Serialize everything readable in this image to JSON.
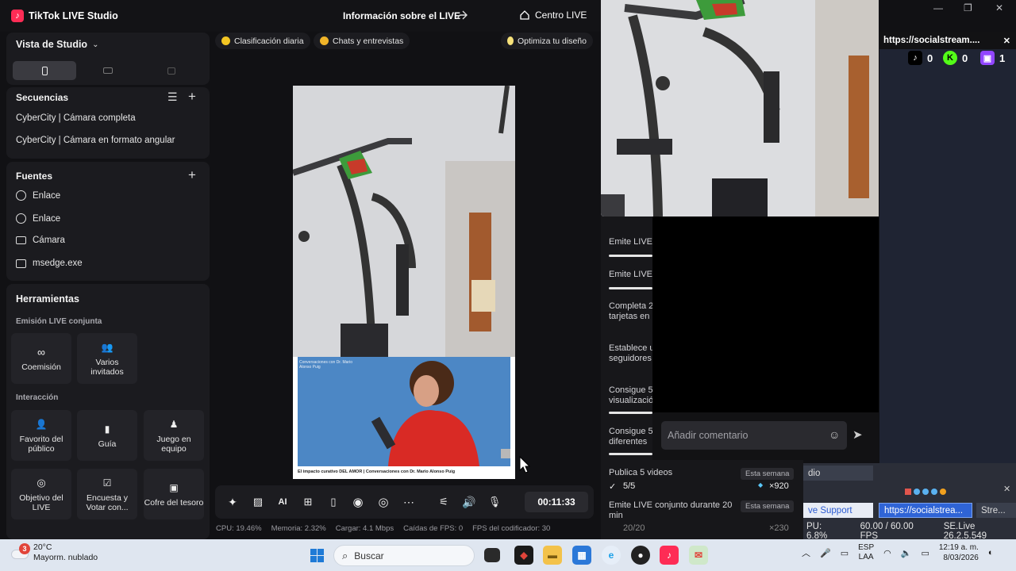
{
  "app": {
    "title": "TikTok LIVE Studio",
    "center_title": "Información sobre el LIVE",
    "live_center": "Centro LIVE"
  },
  "sidebar": {
    "studio_view": "Vista de Studio",
    "sequences_title": "Secuencias",
    "sequences": [
      "CyberCity | Cámara completa",
      "CyberCity | Cámara en formato angular"
    ],
    "sources_title": "Fuentes",
    "sources": [
      {
        "label": "Enlace",
        "icon": "globe-icon"
      },
      {
        "label": "Enlace",
        "icon": "globe-icon"
      },
      {
        "label": "Cámara",
        "icon": "camera-icon"
      },
      {
        "label": "msedge.exe",
        "icon": "window-icon"
      }
    ],
    "tools_title": "Herramientas",
    "co_live_title": "Emisión LIVE conjunta",
    "co_live_tools": [
      "Coemisión",
      "Varios invitados"
    ],
    "interaction_title": "Interacción",
    "interaction_tools": [
      "Favorito del público",
      "Guía",
      "Juego en equipo",
      "Objetivo del LIVE",
      "Encuesta y Votar con...",
      "Cofre del tesoro"
    ]
  },
  "chips": {
    "daily_rank": "Clasificación diaria",
    "chats": "Chats y entrevistas",
    "optimize": "Optimiza tu diseño"
  },
  "preview": {
    "overlay_small": "Conversaciones con Dr. Mario Alonso Puig",
    "caption": "El impacto curativo DEL AMOR | Conversaciones con Dr. Mario Alonso Puig"
  },
  "controls": {
    "timer": "00:11:33"
  },
  "stats": {
    "cpu": "CPU: 19.46%",
    "memory": "Memoria: 2.32%",
    "upload": "Cargar: 4.1 Mbps",
    "fps_drops": "Caídas de FPS: 0",
    "encoder_fps": "FPS del codificador: 30"
  },
  "missions": [
    {
      "text": "Emite LIVE"
    },
    {
      "text": "Emite LIVE"
    },
    {
      "text": "Completa 2 tarjetas en"
    },
    {
      "text": "Establece u seguidores"
    },
    {
      "text": "Consigue 5 visualizació"
    },
    {
      "text": "Consigue 5 diferentes"
    },
    {
      "text": "Publica 5 videos",
      "badge": "Esta semana",
      "progress": "5/5",
      "reward": "×920"
    },
    {
      "text": "Emite LIVE conjunto durante 20 min",
      "badge": "Esta semana",
      "progress": "20/20",
      "reward": "×230"
    }
  ],
  "comment": {
    "placeholder": "Añadir comentario"
  },
  "socialstream": {
    "url": "https://socialstream....",
    "counts": {
      "tiktok": "0",
      "kick": "0",
      "twitch": "1"
    }
  },
  "obs": {
    "btn_dio": "dio",
    "btn_support": "ve Support",
    "btn_url": "https://socialstrea...",
    "btn_stre": "Stre...",
    "cpu": "PU: 6.8%",
    "fps": "60.00 / 60.00 FPS",
    "version": "SE.Live 26.2.5.549"
  },
  "taskbar": {
    "temp": "20°C",
    "weather": "Mayorm. nublado",
    "weather_badge": "3",
    "search": "Buscar",
    "lang1": "ESP",
    "lang2": "LAA",
    "time": "12:19 a. m.",
    "date": "8/03/2026"
  },
  "colors": {
    "accent": "#fe2c55",
    "kick": "#53fc18",
    "twitch": "#9146ff"
  }
}
